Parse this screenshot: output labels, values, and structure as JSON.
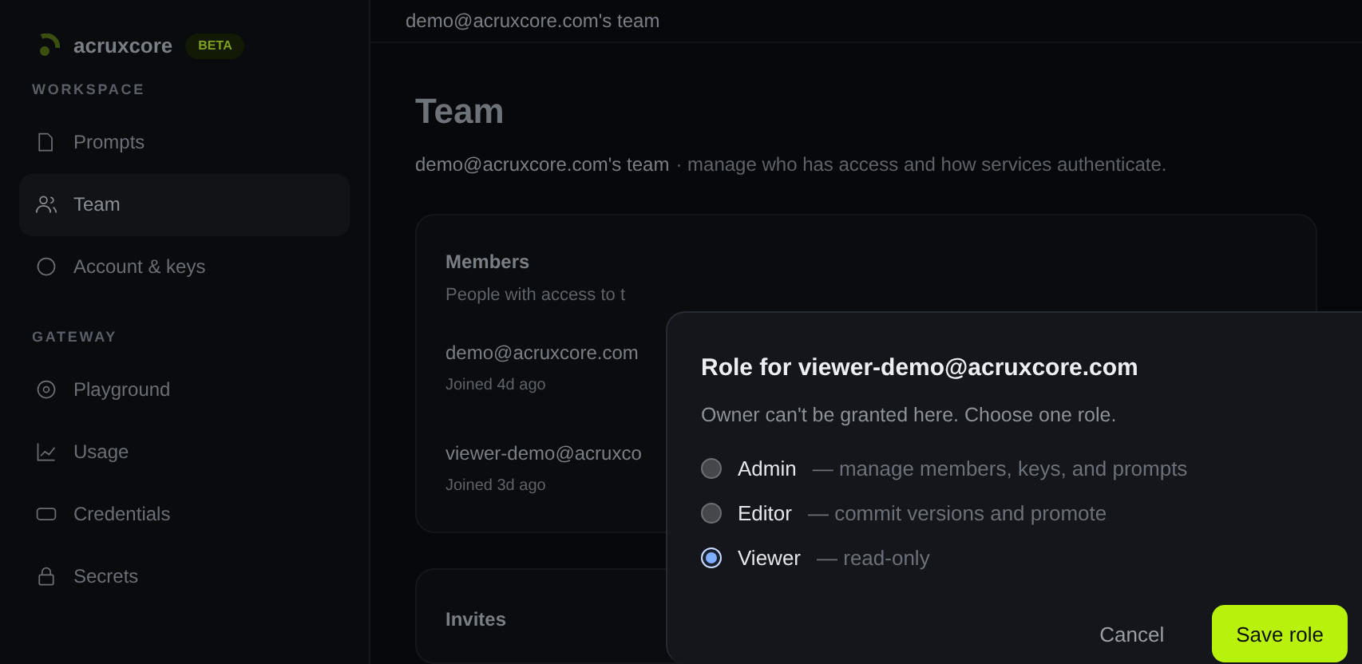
{
  "brand": {
    "name": "acruxcore",
    "badge": "BETA"
  },
  "sidebar": {
    "sections": [
      {
        "heading": "WORKSPACE",
        "items": [
          {
            "label": "Prompts",
            "selected": false
          },
          {
            "label": "Team",
            "selected": true
          },
          {
            "label": "Account & keys",
            "selected": false
          }
        ]
      },
      {
        "heading": "GATEWAY",
        "items": [
          {
            "label": "Playground",
            "selected": false
          },
          {
            "label": "Usage",
            "selected": false
          },
          {
            "label": "Credentials",
            "selected": false
          },
          {
            "label": "Secrets",
            "selected": false
          }
        ]
      }
    ]
  },
  "header": {
    "title": "demo@acruxcore.com's team"
  },
  "page": {
    "title": "Team",
    "team": "demo@acruxcore.com's team",
    "description": "· manage who has access and how services authenticate."
  },
  "members": {
    "title": "Members",
    "subtitle": "People with access to t",
    "rows": [
      {
        "email": "demo@acruxcore.com",
        "joined": "Joined 4d ago"
      },
      {
        "email": "viewer-demo@acruxco",
        "joined": "Joined 3d ago"
      }
    ]
  },
  "invites": {
    "title": "Invites"
  },
  "dialog": {
    "title": "Role for viewer-demo@acruxcore.com",
    "subtitle": "Owner can't be granted here. Choose one role.",
    "roles": [
      {
        "label": "Admin",
        "description": "— manage members, keys, and prompts",
        "selected": false
      },
      {
        "label": "Editor",
        "description": "— commit versions and promote",
        "selected": false
      },
      {
        "label": "Viewer",
        "description": "— read-only",
        "selected": true
      }
    ],
    "cancel": "Cancel",
    "save": "Save role"
  }
}
